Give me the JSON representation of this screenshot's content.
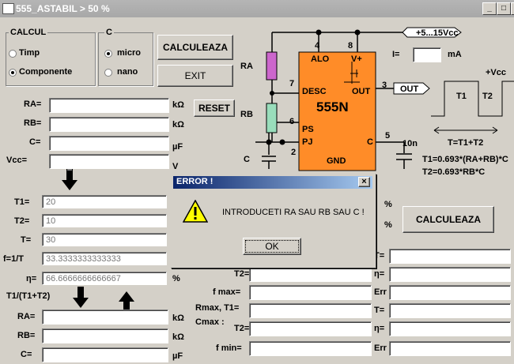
{
  "window": {
    "title": "555_ASTABIL > 50 %",
    "min": "_",
    "max": "□",
    "close": "x"
  },
  "calcul": {
    "title": "CALCUL",
    "opt1": "Timp",
    "opt2": "Componente",
    "selected": "Componente"
  },
  "c_group": {
    "title": "C",
    "opt1": "micro",
    "opt2": "nano",
    "selected": "micro"
  },
  "buttons": {
    "calculeaza_top": "CALCULEAZA",
    "exit": "EXIT",
    "reset": "RESET",
    "calculeaza_right": "CALCULEAZA",
    "ok": "OK"
  },
  "inputs_top": [
    {
      "label": "RA=",
      "unit": "kΩ",
      "value": ""
    },
    {
      "label": "RB=",
      "unit": "kΩ",
      "value": ""
    },
    {
      "label": "C=",
      "unit": "µF",
      "value": ""
    },
    {
      "label": "Vcc=",
      "unit": "V",
      "value": ""
    }
  ],
  "results": [
    {
      "label": "T1=",
      "value": "20"
    },
    {
      "label": "T2=",
      "value": "10"
    },
    {
      "label": "T=",
      "value": "30"
    },
    {
      "label": "f=1/T",
      "value": "33.3333333333333"
    },
    {
      "label": "η=",
      "value": "66.6666666666667",
      "unit": "%"
    }
  ],
  "ratio_label": "T1/(T1+T2)",
  "inputs_bottom": [
    {
      "label": "RA=",
      "unit": "kΩ",
      "value": ""
    },
    {
      "label": "RB=",
      "unit": "kΩ",
      "value": ""
    },
    {
      "label": "C=",
      "unit": "µF",
      "value": ""
    }
  ],
  "circuit": {
    "supply": "+5...15Vcc",
    "chip_name": "555N",
    "pins": {
      "alo": "ALO",
      "vplus": "V+",
      "desc": "DESC",
      "out": "OUT",
      "ps": "PS",
      "pj": "PJ",
      "c": "C",
      "gnd": "GND"
    },
    "pin_numbers": {
      "p4": "4",
      "p8": "8",
      "p7": "7",
      "p3": "3",
      "p6": "6",
      "p2": "2",
      "p5": "5"
    },
    "ra": "RA",
    "rb": "RB",
    "c": "C",
    "cap10n": "10n",
    "out_label": "OUT",
    "current_label": "I=",
    "current_unit": "mA",
    "current_value": ""
  },
  "waveform": {
    "vcc": "+Vcc",
    "t1": "T1",
    "t2": "T2",
    "t_eq": "T=T1+T2",
    "f1": "T1=0.693*(RA+RB)*C",
    "f2": "T2=0.693*RB*C"
  },
  "lower_right": {
    "pct_unit": "%",
    "right_labels": [
      "T=",
      "η=",
      "Err",
      "T=",
      "η=",
      "Err"
    ],
    "left_labels": {
      "t2": "T2=",
      "fmax": "f max=",
      "rmax_line1": "Rmax, T1=",
      "rmax_line2": "Cmax :",
      "t2b": "T2=",
      "fmin": "f min="
    }
  },
  "dialog": {
    "title": "ERROR !",
    "message": "INTRODUCETI  RA SAU RB SAU C !",
    "close": "×"
  }
}
